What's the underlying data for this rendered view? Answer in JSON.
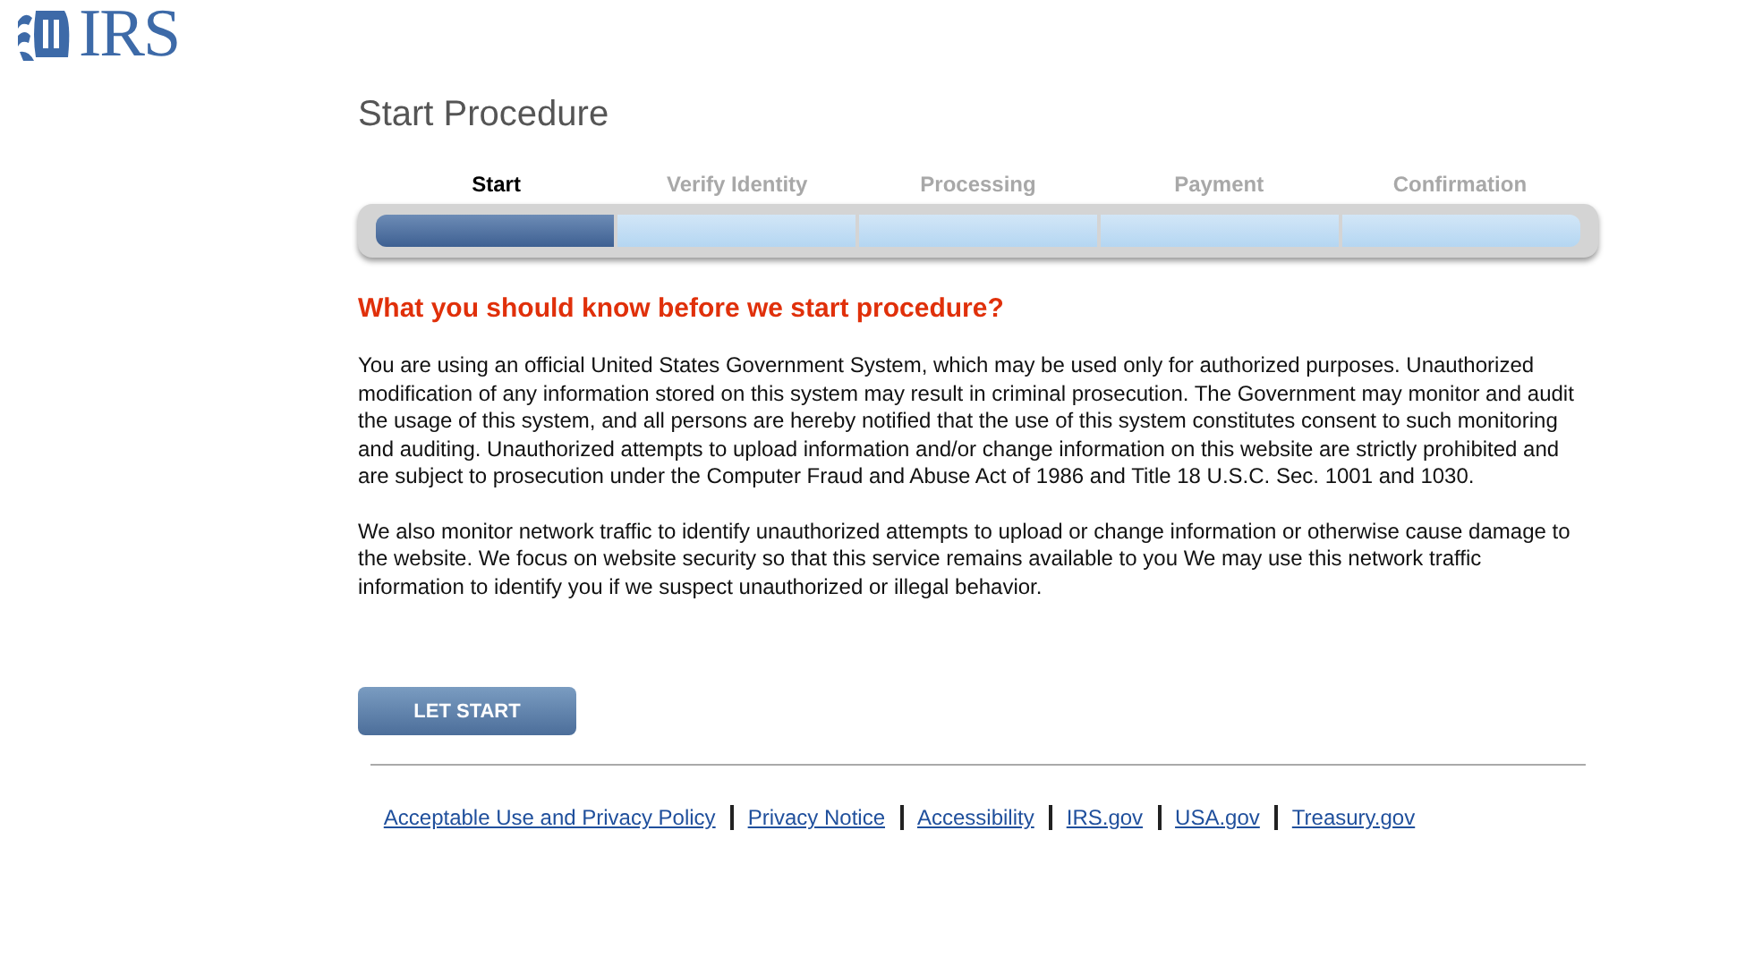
{
  "logo": {
    "text": "IRS"
  },
  "title": "Start Procedure",
  "steps": [
    {
      "label": "Start",
      "selected": true
    },
    {
      "label": "Verify Identity",
      "selected": false
    },
    {
      "label": "Processing",
      "selected": false
    },
    {
      "label": "Payment",
      "selected": false
    },
    {
      "label": "Confirmation",
      "selected": false
    }
  ],
  "heading": "What you should know before we start procedure?",
  "paragraphs": [
    "You are using an official United States Government System, which may be used only for authorized purposes. Unauthorized modification of any information stored on this system may result in criminal prosecution. The Government may monitor and audit the usage of this system, and all persons are hereby notified that the use of this system constitutes consent to such monitoring and auditing. Unauthorized attempts to upload information and/or change information on this website are strictly prohibited and are subject to prosecution under the Computer Fraud and Abuse Act of 1986 and Title 18 U.S.C. Sec. 1001 and 1030.",
    "We also monitor network traffic to identify unauthorized attempts to upload or change information or otherwise cause damage to the website. We focus on website security so that this service remains available to you We may use this network traffic information to identify you if we suspect unauthorized or illegal behavior."
  ],
  "button": "LET START",
  "footer_links": [
    "Acceptable Use and Privacy Policy",
    "Privacy Notice",
    "Accessibility",
    "IRS.gov",
    "USA.gov",
    "Treasury.gov"
  ]
}
